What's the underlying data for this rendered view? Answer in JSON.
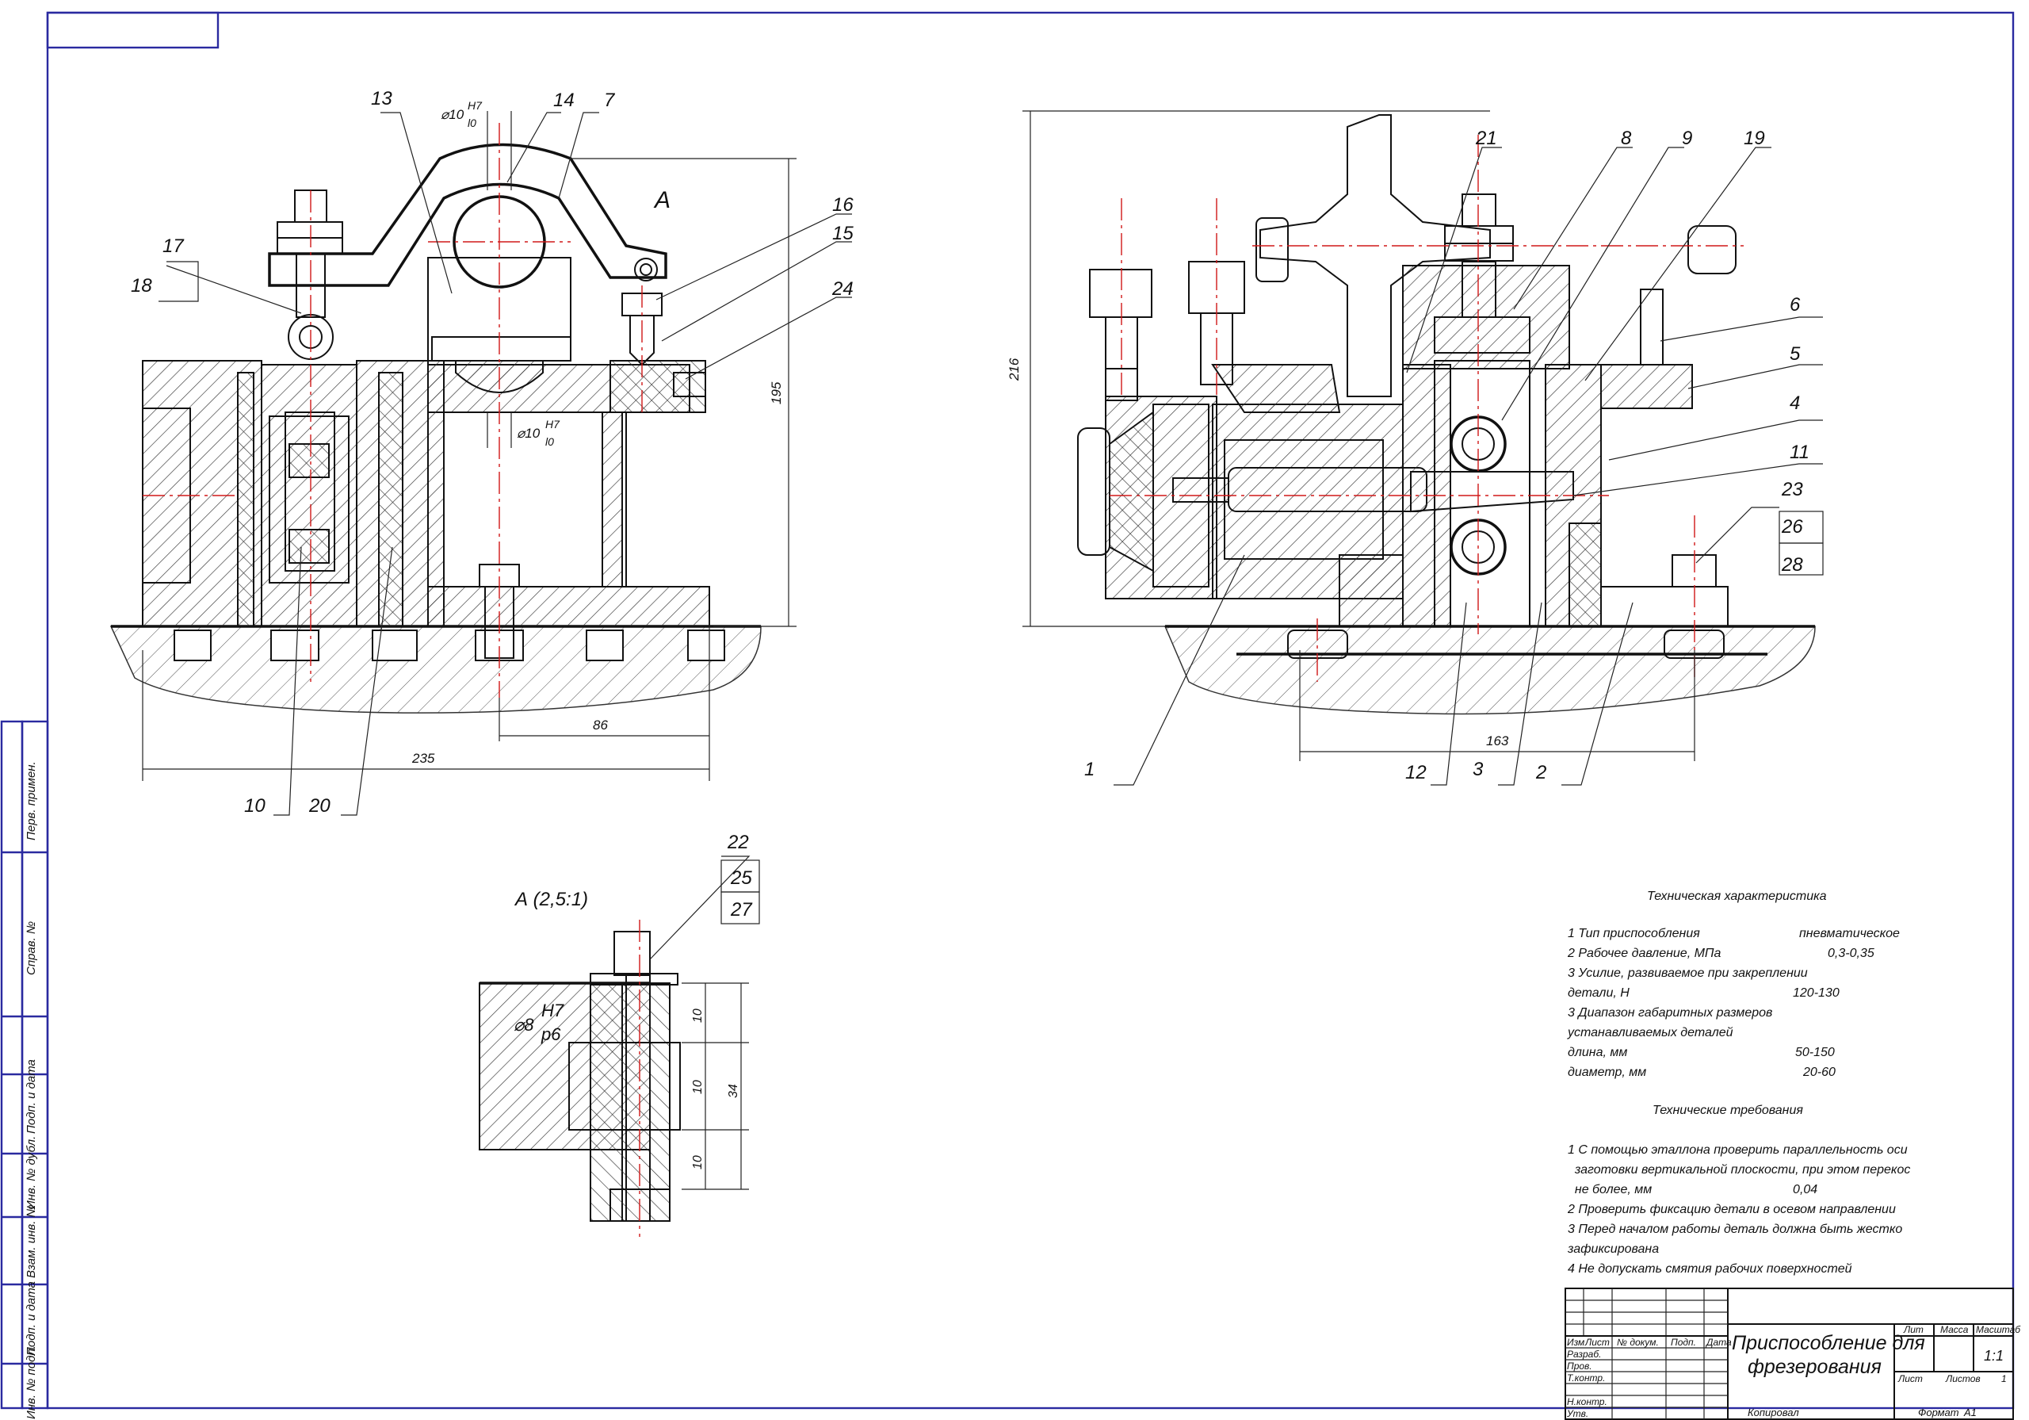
{
  "callouts_left": [
    "13",
    "14",
    "7",
    "17",
    "18",
    "16",
    "15",
    "24",
    "10",
    "20"
  ],
  "callouts_right": [
    "21",
    "8",
    "9",
    "19",
    "6",
    "5",
    "4",
    "11",
    "23",
    "26",
    "28",
    "1",
    "12",
    "3",
    "2"
  ],
  "callouts_section": [
    "22",
    "25",
    "27"
  ],
  "view_arrow": "А",
  "section_title": "А (2,5:1)",
  "fit_top": {
    "dia": "⌀10",
    "up": "H7",
    "low": "l0"
  },
  "fit_mid": {
    "dia": "⌀10",
    "up": "H7",
    "low": "l0"
  },
  "fit_section": {
    "dia": "⌀8",
    "up": "H7",
    "low": "p6"
  },
  "dims": {
    "d195": "195",
    "d86": "86",
    "d235": "235",
    "d216": "216",
    "d163": "163",
    "s10a": "10",
    "s10b": "10",
    "s10c": "10",
    "s34": "34"
  },
  "spec": {
    "title": "Техническая характеристика",
    "rows": [
      {
        "l": "1 Тип приспособления",
        "v": "пневматическое"
      },
      {
        "l": "2 Рабочее давление, МПа",
        "v": "0,3-0,35"
      },
      {
        "l": "3 Усилие, развиваемое при закреплении",
        "v": ""
      },
      {
        "l": "детали, Н",
        "v": "120-130"
      },
      {
        "l": "3 Диапазон габаритных размеров",
        "v": ""
      },
      {
        "l": "устанавливаемых деталей",
        "v": ""
      },
      {
        "l": "  длина, мм",
        "v": "50-150"
      },
      {
        "l": "  диаметр, мм",
        "v": "20-60"
      }
    ]
  },
  "req": {
    "title": "Технические требования",
    "lines": [
      "1 С помощью эталлона проверить параллельность оси",
      "  заготовки вертикальной плоскости, при этом перекос",
      "  не более, мм                                        0,04",
      "2 Проверить фиксацию детали в осевом направлении",
      "3 Перед началом работы деталь должна быть жестко",
      "зафиксирована",
      "4 Не допускать смятия рабочих поверхностей"
    ]
  },
  "stamp": {
    "title1": "Приспособление для",
    "title2": "фрезерования",
    "h_izm": "Изм",
    "h_list": "Лист",
    "h_doc": "№ докум.",
    "h_podp": "Подп.",
    "h_data": "Дата",
    "r_razrab": "Разраб.",
    "r_prov": "Пров.",
    "r_tkontr": "Т.контр.",
    "r_nkontr": "Н.контр.",
    "r_utv": "Утв.",
    "lit": "Лит",
    "massa": "Масса",
    "masshtab": "Масштаб",
    "scale_val": "1:1",
    "list": "Лист",
    "listov": "Листов",
    "listov_val": "1",
    "kopiroval": "Копировал",
    "format": "Формат",
    "format_val": "А1"
  },
  "side_columns": [
    "Перв. примен.",
    "Справ. №",
    "Подп. и дата",
    "Инв. № дубл.",
    "Взам. инв. №",
    "Подп. и дата",
    "Инв. № подл."
  ]
}
